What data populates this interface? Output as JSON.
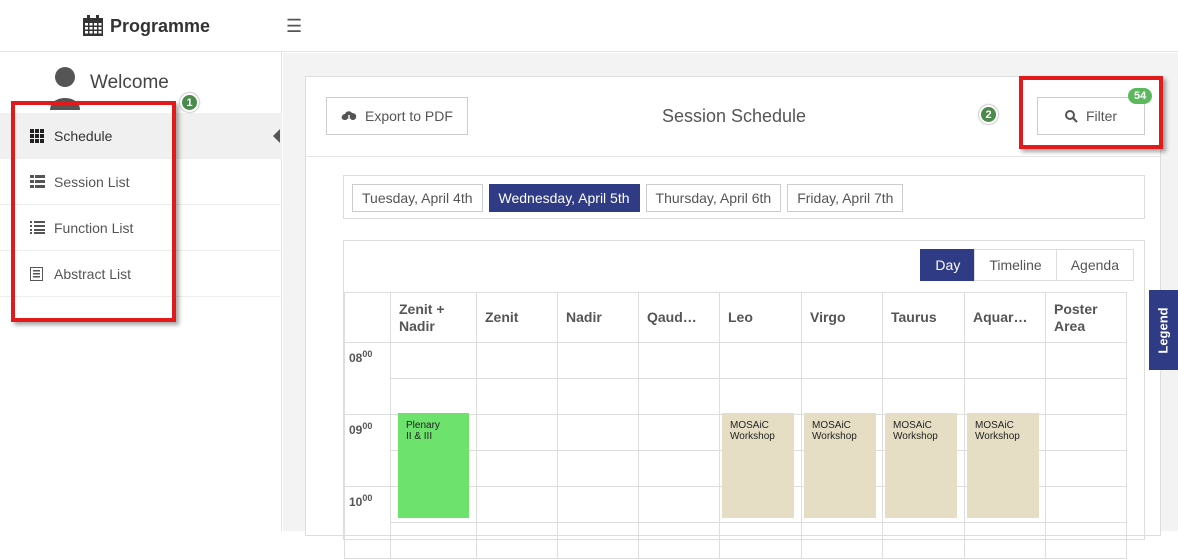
{
  "app": {
    "title": "Programme"
  },
  "sidebar": {
    "welcome": "Welcome",
    "items": [
      {
        "label": "Schedule",
        "icon": "grid-icon"
      },
      {
        "label": "Session List",
        "icon": "list-icon"
      },
      {
        "label": "Function List",
        "icon": "list-lines-icon"
      },
      {
        "label": "Abstract List",
        "icon": "document-icon"
      }
    ]
  },
  "annotations": {
    "badge1": "1",
    "badge2": "2"
  },
  "panel": {
    "export_label": "Export to PDF",
    "title": "Session Schedule",
    "filter_label": "Filter",
    "filter_count": "54"
  },
  "days": [
    "Tuesday, April 4th",
    "Wednesday, April 5th",
    "Thursday, April 6th",
    "Friday, April 7th"
  ],
  "views": [
    "Day",
    "Timeline",
    "Agenda"
  ],
  "rooms": [
    "Zenit + Nadir",
    "Zenit",
    "Nadir",
    "Qaud…",
    "Leo",
    "Virgo",
    "Taurus",
    "Aquar…",
    "Poster Area"
  ],
  "times": [
    {
      "hour": "08",
      "min": "00"
    },
    {
      "hour": "09",
      "min": "00"
    },
    {
      "hour": "10",
      "min": "00"
    }
  ],
  "events": [
    {
      "room": "Zenit + Nadir",
      "line1": "Plenary",
      "line2": "II & III",
      "color": "#6de36d"
    },
    {
      "room": "Leo",
      "line1": "MOSAiC",
      "line2": "Workshop",
      "color": "#e6dec4"
    },
    {
      "room": "Virgo",
      "line1": "MOSAiC",
      "line2": "Workshop",
      "color": "#e6dec4"
    },
    {
      "room": "Taurus",
      "line1": "MOSAiC",
      "line2": "Workshop",
      "color": "#e6dec4"
    },
    {
      "room": "Aquar…",
      "line1": "MOSAiC",
      "line2": "Workshop",
      "color": "#e6dec4"
    }
  ],
  "legend": "Legend",
  "colors": {
    "accent": "#2f3b84",
    "highlight": "#e21a1a",
    "badge": "#5cb85c"
  }
}
